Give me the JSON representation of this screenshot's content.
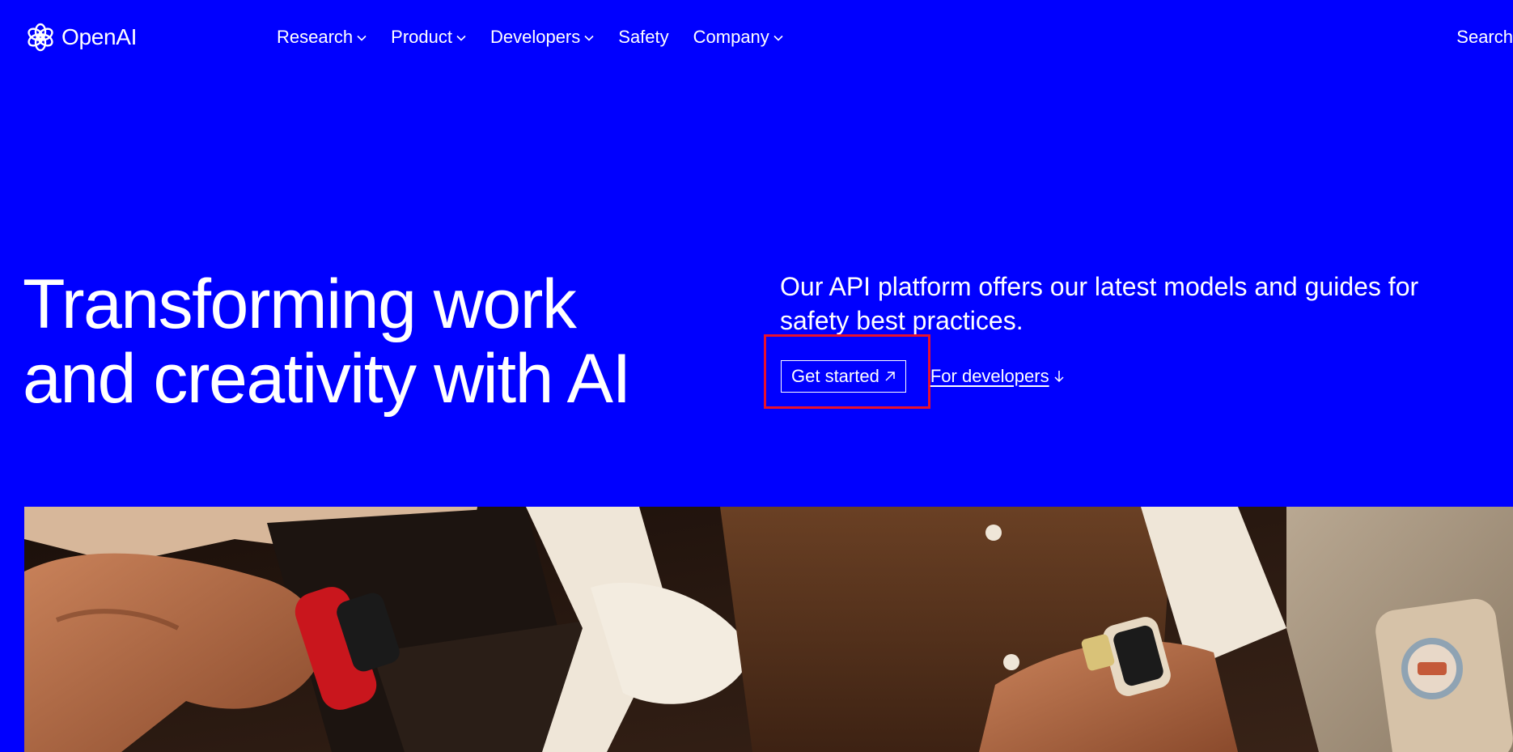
{
  "header": {
    "brand": "OpenAI",
    "nav": [
      {
        "label": "Research",
        "has_dropdown": true
      },
      {
        "label": "Product",
        "has_dropdown": true
      },
      {
        "label": "Developers",
        "has_dropdown": true
      },
      {
        "label": "Safety",
        "has_dropdown": false
      },
      {
        "label": "Company",
        "has_dropdown": true
      }
    ],
    "search_label": "Search"
  },
  "hero": {
    "title_line1": "Transforming work",
    "title_line2": "and creativity with AI",
    "subtitle": "Our API platform offers our latest models and guides for safety best practices.",
    "primary_cta": "Get started",
    "secondary_cta": "For developers"
  },
  "icons": {
    "logo": "openai-logo-icon",
    "dropdown": "chevron-down-icon",
    "external": "arrow-up-right-icon",
    "scroll": "arrow-down-icon"
  },
  "colors": {
    "background": "#0000ff",
    "text": "#ffffff",
    "highlight": "#e8112d"
  }
}
